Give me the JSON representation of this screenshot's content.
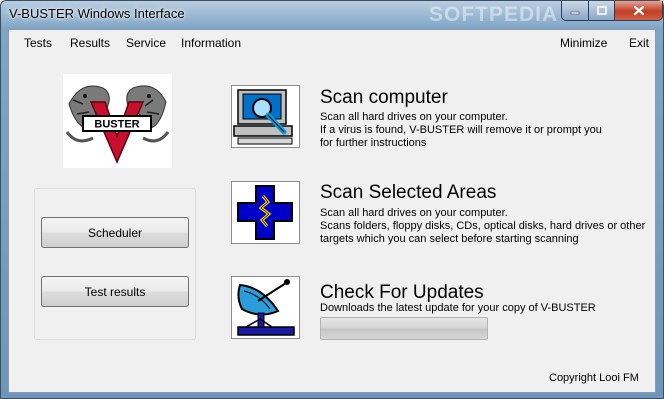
{
  "window": {
    "title": "V-BUSTER Windows Interface",
    "watermark": "SOFTPEDIA"
  },
  "menu": {
    "left": [
      "Tests",
      "Results",
      "Service",
      "Information"
    ],
    "right": [
      "Minimize",
      "Exit"
    ]
  },
  "logo": {
    "text": "BUSTER",
    "letter": "V"
  },
  "sidebar": {
    "buttons": [
      "Scheduler",
      "Test results"
    ]
  },
  "actions": [
    {
      "title": "Scan computer",
      "lines": [
        "Scan all hard drives on your computer.",
        "If a virus is found, V-BUSTER will remove it or prompt you",
        "for further instructions"
      ],
      "icon": "computer-scan-icon"
    },
    {
      "title": "Scan Selected Areas",
      "lines": [
        "Scan all hard drives on your computer.",
        "Scans folders, floppy disks, CDs, optical disks, hard drives or other",
        "targets which you can select before starting scanning"
      ],
      "icon": "blue-cross-icon"
    },
    {
      "title": "Check For Updates",
      "lines": [
        "Downloads the latest update for your copy of V-BUSTER"
      ],
      "icon": "satellite-dish-icon"
    }
  ],
  "update_progress": 0,
  "footer": {
    "copyright": "Copyright Looi FM"
  },
  "colors": {
    "titlebar": "#7fa5c6",
    "client": "#f0f0f0",
    "cross": "#0000c8",
    "close": "#c13c22"
  }
}
